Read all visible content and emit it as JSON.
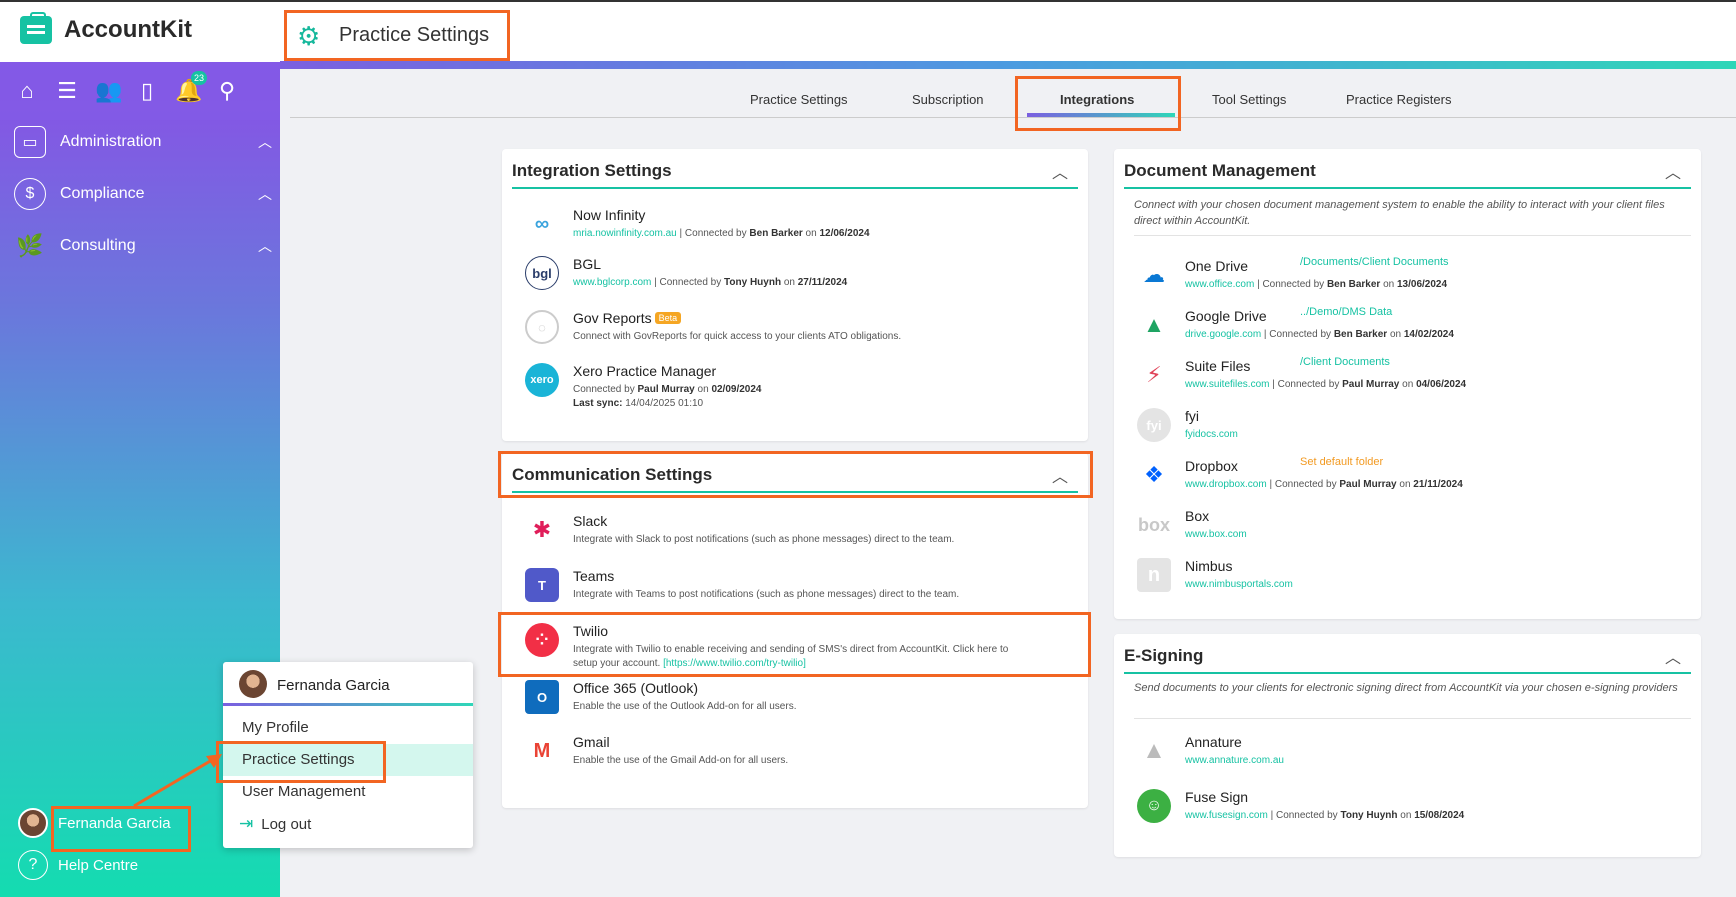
{
  "app": {
    "name": "AccountKit"
  },
  "header": {
    "title": "Practice Settings"
  },
  "sidebar": {
    "notification_count": "23",
    "nav": [
      {
        "label": "Administration"
      },
      {
        "label": "Compliance"
      },
      {
        "label": "Consulting"
      }
    ],
    "user_name": "Fernanda Garcia",
    "help_label": "Help Centre"
  },
  "tabs": [
    "Practice Settings",
    "Subscription",
    "Integrations",
    "Tool Settings",
    "Practice Registers"
  ],
  "integration_settings": {
    "title": "Integration Settings",
    "items": [
      {
        "name": "Now Infinity",
        "link": "mria.nowinfinity.com.au",
        "connected_by_prefix": " | Connected by ",
        "user": "Ben Barker",
        "on": " on ",
        "date": "12/06/2024"
      },
      {
        "name": "BGL",
        "link": "www.bglcorp.com",
        "connected_by_prefix": " | Connected by ",
        "user": "Tony Huynh",
        "on": " on ",
        "date": "27/11/2024"
      },
      {
        "name": "Gov Reports",
        "badge": "Beta",
        "desc": "Connect with GovReports for quick access to your clients ATO obligations."
      },
      {
        "name": "Xero Practice Manager",
        "connected_by": "Connected by ",
        "user": "Paul Murray",
        "on": " on ",
        "date": "02/09/2024",
        "last_sync_label": "Last sync:",
        "last_sync": " 14/04/2025 01:10"
      }
    ]
  },
  "communication_settings": {
    "title": "Communication Settings",
    "items": [
      {
        "name": "Slack",
        "desc": "Integrate with Slack to post notifications (such as phone messages) direct to the team."
      },
      {
        "name": "Teams",
        "desc": "Integrate with Teams to post notifications (such as phone messages) direct to the team."
      },
      {
        "name": "Twilio",
        "desc": "Integrate with Twilio to enable receiving and sending of SMS's direct from AccountKit. Click here to",
        "desc2": "setup your account.",
        "link": "[https://www.twilio.com/try-twilio]"
      },
      {
        "name": "Office 365 (Outlook)",
        "desc": "Enable the use of the Outlook Add-on for all users."
      },
      {
        "name": "Gmail",
        "desc": "Enable the use of the Gmail Add-on for all users."
      }
    ]
  },
  "document_management": {
    "title": "Document Management",
    "desc": "Connect with your chosen document management system to enable the ability to interact with your client files direct within AccountKit.",
    "items": [
      {
        "name": "One Drive",
        "path": "/Documents/Client Documents",
        "link": "www.office.com",
        "connected_by_prefix": " | Connected by ",
        "user": "Ben Barker",
        "on": " on ",
        "date": "13/06/2024"
      },
      {
        "name": "Google Drive",
        "path": "../Demo/DMS Data",
        "link": "drive.google.com",
        "connected_by_prefix": " | Connected by ",
        "user": "Ben Barker",
        "on": " on ",
        "date": "14/02/2024"
      },
      {
        "name": "Suite Files",
        "path": "/Client Documents",
        "link": "www.suitefiles.com",
        "connected_by_prefix": " | Connected by ",
        "user": "Paul Murray",
        "on": " on ",
        "date": "04/06/2024"
      },
      {
        "name": "fyi",
        "link": "fyidocs.com"
      },
      {
        "name": "Dropbox",
        "path": "Set default folder",
        "link": "www.dropbox.com",
        "connected_by_prefix": " | Connected by ",
        "user": "Paul Murray",
        "on": " on ",
        "date": "21/11/2024"
      },
      {
        "name": "Box",
        "link": "www.box.com"
      },
      {
        "name": "Nimbus",
        "link": "www.nimbusportals.com"
      }
    ]
  },
  "esigning": {
    "title": "E-Signing",
    "desc": "Send documents to your clients for electronic signing direct from AccountKit via your chosen e-signing providers",
    "items": [
      {
        "name": "Annature",
        "link": "www.annature.com.au"
      },
      {
        "name": "Fuse Sign",
        "link": "www.fusesign.com",
        "connected_by_prefix": " | Connected by ",
        "user": "Tony Huynh",
        "on": " on ",
        "date": "15/08/2024"
      }
    ]
  },
  "user_menu": {
    "user_name": "Fernanda Garcia",
    "items": [
      "My Profile",
      "Practice Settings",
      "User Management",
      "Log out"
    ]
  },
  "colors": {
    "accent": "#16c2a3",
    "highlight": "#f26522",
    "purple": "#7b5fe0"
  }
}
